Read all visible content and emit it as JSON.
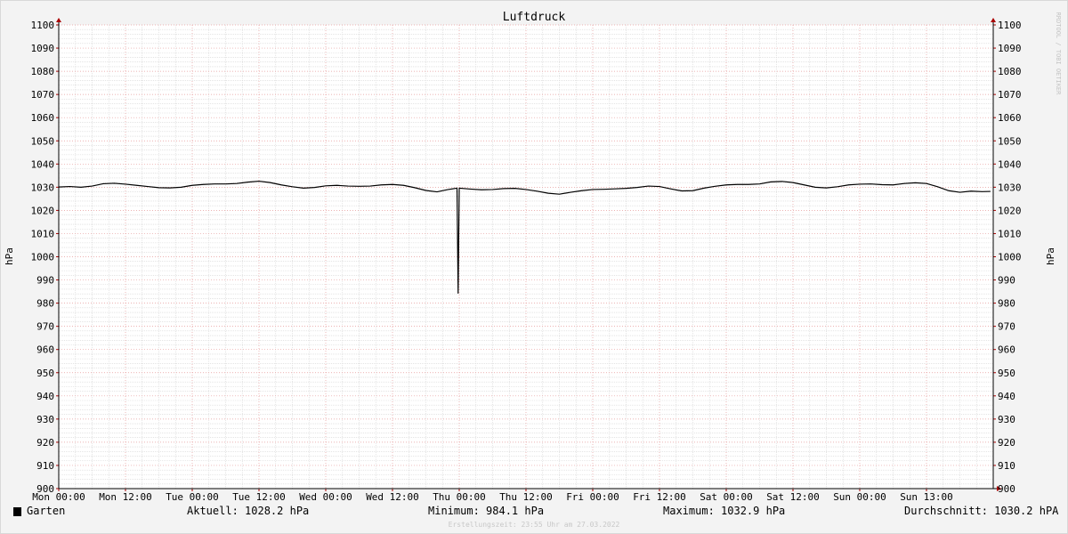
{
  "chart_data": {
    "type": "line",
    "title": "Luftdruck",
    "ylabel": "hPa",
    "ylabel_right": "hPa",
    "ylim": [
      900,
      1100
    ],
    "y_ticks": [
      900,
      910,
      920,
      930,
      940,
      950,
      960,
      970,
      980,
      990,
      1000,
      1010,
      1020,
      1030,
      1040,
      1050,
      1060,
      1070,
      1080,
      1090,
      1100
    ],
    "x_range_hours": [
      0,
      168
    ],
    "x_ticks": [
      {
        "h": 0,
        "label": "Mon 00:00"
      },
      {
        "h": 12,
        "label": "Mon 12:00"
      },
      {
        "h": 24,
        "label": "Tue 00:00"
      },
      {
        "h": 36,
        "label": "Tue 12:00"
      },
      {
        "h": 48,
        "label": "Wed 00:00"
      },
      {
        "h": 60,
        "label": "Wed 12:00"
      },
      {
        "h": 72,
        "label": "Thu 00:00"
      },
      {
        "h": 84,
        "label": "Thu 12:00"
      },
      {
        "h": 96,
        "label": "Fri 00:00"
      },
      {
        "h": 108,
        "label": "Fri 12:00"
      },
      {
        "h": 120,
        "label": "Sat 00:00"
      },
      {
        "h": 132,
        "label": "Sat 12:00"
      },
      {
        "h": 144,
        "label": "Sun 00:00"
      },
      {
        "h": 156,
        "label": "Sun 13:00"
      }
    ],
    "series": [
      {
        "name": "Garten",
        "color": "#000000",
        "points": [
          [
            0,
            1030.1
          ],
          [
            2,
            1030.3
          ],
          [
            4,
            1030.0
          ],
          [
            6,
            1030.5
          ],
          [
            8,
            1031.5
          ],
          [
            10,
            1031.7
          ],
          [
            12,
            1031.3
          ],
          [
            14,
            1030.8
          ],
          [
            16,
            1030.3
          ],
          [
            18,
            1029.8
          ],
          [
            20,
            1029.7
          ],
          [
            22,
            1030.0
          ],
          [
            24,
            1030.8
          ],
          [
            26,
            1031.2
          ],
          [
            28,
            1031.4
          ],
          [
            30,
            1031.4
          ],
          [
            32,
            1031.6
          ],
          [
            34,
            1032.2
          ],
          [
            36,
            1032.6
          ],
          [
            38,
            1032.0
          ],
          [
            40,
            1031.0
          ],
          [
            42,
            1030.2
          ],
          [
            44,
            1029.6
          ],
          [
            46,
            1029.9
          ],
          [
            48,
            1030.6
          ],
          [
            50,
            1030.8
          ],
          [
            52,
            1030.5
          ],
          [
            54,
            1030.4
          ],
          [
            56,
            1030.5
          ],
          [
            58,
            1031.0
          ],
          [
            60,
            1031.2
          ],
          [
            62,
            1030.8
          ],
          [
            64,
            1029.8
          ],
          [
            66,
            1028.6
          ],
          [
            68,
            1028.0
          ],
          [
            70,
            1029.0
          ],
          [
            71.6,
            1029.6
          ],
          [
            71.8,
            984.1
          ],
          [
            72.0,
            1029.6
          ],
          [
            74,
            1029.2
          ],
          [
            76,
            1028.9
          ],
          [
            78,
            1029.0
          ],
          [
            80,
            1029.4
          ],
          [
            82,
            1029.5
          ],
          [
            84,
            1029.0
          ],
          [
            86,
            1028.3
          ],
          [
            88,
            1027.4
          ],
          [
            90,
            1027.0
          ],
          [
            92,
            1027.8
          ],
          [
            94,
            1028.5
          ],
          [
            96,
            1029.0
          ],
          [
            98,
            1029.1
          ],
          [
            100,
            1029.3
          ],
          [
            102,
            1029.5
          ],
          [
            104,
            1029.9
          ],
          [
            106,
            1030.5
          ],
          [
            108,
            1030.3
          ],
          [
            110,
            1029.3
          ],
          [
            112,
            1028.4
          ],
          [
            114,
            1028.5
          ],
          [
            116,
            1029.6
          ],
          [
            118,
            1030.4
          ],
          [
            120,
            1031.0
          ],
          [
            122,
            1031.2
          ],
          [
            124,
            1031.2
          ],
          [
            126,
            1031.4
          ],
          [
            128,
            1032.3
          ],
          [
            130,
            1032.5
          ],
          [
            132,
            1032.0
          ],
          [
            134,
            1031.0
          ],
          [
            136,
            1030.0
          ],
          [
            138,
            1029.7
          ],
          [
            140,
            1030.2
          ],
          [
            142,
            1031.0
          ],
          [
            144,
            1031.3
          ],
          [
            146,
            1031.4
          ],
          [
            148,
            1031.1
          ],
          [
            150,
            1031.0
          ],
          [
            152,
            1031.6
          ],
          [
            154,
            1031.9
          ],
          [
            156,
            1031.6
          ],
          [
            158,
            1030.2
          ],
          [
            160,
            1028.5
          ],
          [
            162,
            1027.8
          ],
          [
            164,
            1028.3
          ],
          [
            166,
            1028.1
          ],
          [
            167.5,
            1028.2
          ]
        ]
      }
    ]
  },
  "legend": {
    "series_name": "Garten",
    "aktuell": "Aktuell: 1028.2 hPa",
    "minimum": "Minimum: 984.1 hPa",
    "maximum": "Maximum: 1032.9 hPa",
    "durchschnitt": "Durchschnitt: 1030.2 hPA"
  },
  "watermark": "RRDTOOL / TOBI OETIKER",
  "timestamp": "Erstellungszeit: 23:55 Uhr am 27.03.2022"
}
